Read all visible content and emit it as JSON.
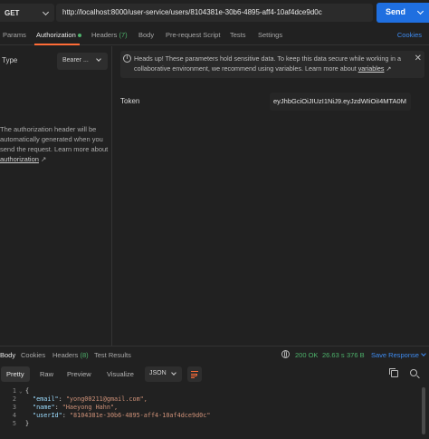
{
  "request": {
    "method": "GET",
    "url": "http://localhost:8000/user-service/users/8104381e-30b6-4895-aff4-10af4dce9d0c",
    "send_label": "Send"
  },
  "req_tabs": {
    "params": "Params",
    "authorization": "Authorization",
    "headers": "Headers",
    "headers_count": "(7)",
    "body": "Body",
    "pre_request": "Pre-request Script",
    "tests": "Tests",
    "settings": "Settings",
    "cookies": "Cookies"
  },
  "auth": {
    "type_label": "Type",
    "type_value": "Bearer ...",
    "desc": "The authorization header will be automatically generated when you send the request. Learn more about ",
    "desc_link": "authorization",
    "desc_link_arrow": "↗",
    "notice_text": "Heads up! These parameters hold sensitive data. To keep this data secure while working in a collaborative environment, we recommend using variables. Learn more about ",
    "notice_link": "variables",
    "notice_link_arrow": "↗",
    "close_icon": "close-icon",
    "token_label": "Token",
    "token_value": "eyJhbGciOiJIUzI1NiJ9.eyJzdWIiOiI4MTA0M"
  },
  "response": {
    "tabs": {
      "body": "Body",
      "cookies": "Cookies",
      "headers": "Headers",
      "headers_count": "(8)",
      "test_results": "Test Results"
    },
    "status": "200 OK",
    "time": "26.63 s",
    "size": "376 B",
    "save_label": "Save Response",
    "views": {
      "pretty": "Pretty",
      "raw": "Raw",
      "preview": "Preview",
      "visualize": "Visualize"
    },
    "format": "JSON",
    "lines": [
      {
        "n": "1",
        "text": "{"
      },
      {
        "n": "2",
        "key": "\"email\"",
        "value": "\"yong00211@gmail.com\","
      },
      {
        "n": "3",
        "key": "\"name\"",
        "value": "\"Haeyong Hahn\","
      },
      {
        "n": "4",
        "key": "\"userId\"",
        "value": "\"8104381e-30b6-4895-aff4-10af4dce9d0c\""
      },
      {
        "n": "5",
        "text": "}"
      }
    ]
  },
  "colors": {
    "accent": "#ff6c37",
    "send": "#1f6fe0",
    "success": "#4db26b",
    "link": "#3e8bf0"
  }
}
